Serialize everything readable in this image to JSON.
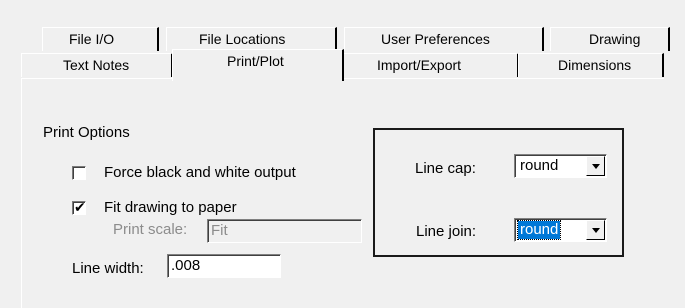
{
  "tabs": {
    "row1": [
      "File I/O",
      "File Locations",
      "User Preferences",
      "Drawing"
    ],
    "row2": [
      "Text Notes",
      "Print/Plot",
      "Import/Export",
      "Dimensions"
    ],
    "active": "Print/Plot"
  },
  "print_options": {
    "heading": "Print Options",
    "force_bw": {
      "label": "Force black and white output",
      "checked": false
    },
    "fit_to_paper": {
      "label": "Fit drawing to paper",
      "checked": true
    },
    "print_scale": {
      "label": "Print scale:",
      "value": "Fit",
      "disabled": true
    },
    "line_width": {
      "label": "Line width:",
      "value": ".008"
    }
  },
  "line_style": {
    "line_cap": {
      "label": "Line cap:",
      "value": "round"
    },
    "line_join": {
      "label": "Line join:",
      "value": "round",
      "selected": true
    }
  },
  "icons": {
    "check": "checkmark-glyph",
    "dropdown": "chevron-down-icon"
  }
}
